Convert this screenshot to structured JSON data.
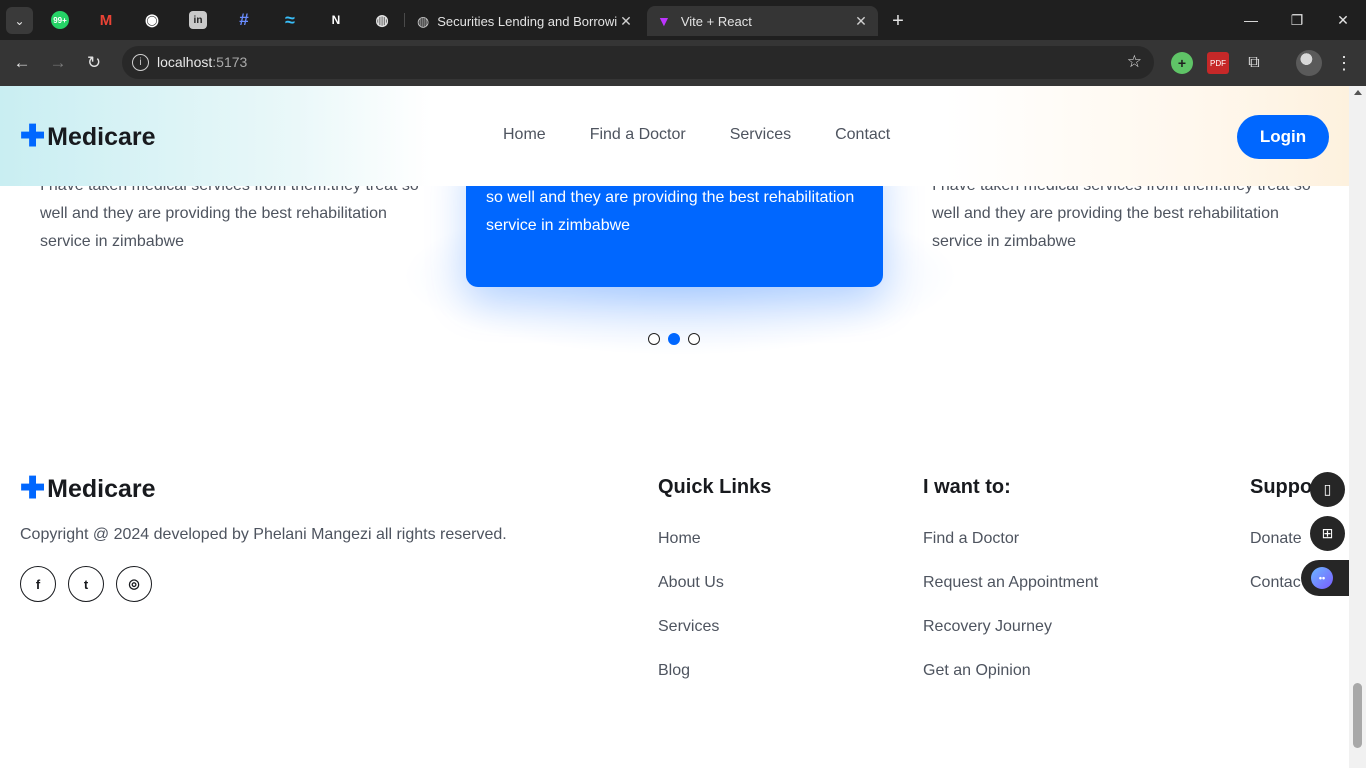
{
  "browser": {
    "tabs": [
      {
        "title": "Securities Lending and Borrowin"
      },
      {
        "title": "Vite + React"
      }
    ],
    "pinned_tabs": [
      {
        "icon": "whatsapp-icon",
        "badge": "99+",
        "color": "#25d366"
      },
      {
        "icon": "gmail-icon",
        "glyph": "M",
        "color": "#ea4335"
      },
      {
        "icon": "github-icon",
        "glyph": "◉",
        "color": "#ffffff"
      },
      {
        "icon": "linkedin-icon",
        "glyph": "in",
        "color": "#0a66c2"
      },
      {
        "icon": "hash-icon",
        "glyph": "#",
        "color": "#6a8dff"
      },
      {
        "icon": "tailwind-icon",
        "glyph": "≈",
        "color": "#38bdf8"
      },
      {
        "icon": "notion-icon",
        "glyph": "N",
        "color": "#ffffff"
      },
      {
        "icon": "copilot-icon",
        "glyph": "◍",
        "color": "#e3e3e3"
      }
    ],
    "address": {
      "host": "localhost",
      "port": ":5173"
    }
  },
  "header": {
    "logo_mark": "✚",
    "logo_text": "Medicare",
    "nav": [
      "Home",
      "Find a Doctor",
      "Services",
      "Contact"
    ],
    "login_label": "Login"
  },
  "testimonials": {
    "left": "I have taken medical services from them.they treat so well and they are providing the best rehabilitation service in zimbabwe",
    "center": "I have taken medical services from them.they treat so well and they are providing the best rehabilitation service in zimbabwe",
    "right": "I have taken medical services from them.they treat so well and they are providing the best rehabilitation service in zimbabwe",
    "active_slide": 2,
    "slide_count": 3
  },
  "footer": {
    "logo_mark": "✚",
    "logo_text": "Medicare",
    "copyright": "Copyright @ 2024 developed by Phelani Mangezi all rights reserved.",
    "social": [
      "facebook-icon",
      "twitter-icon",
      "instagram-icon"
    ],
    "quick_links": {
      "title": "Quick Links",
      "links": [
        "Home",
        "About Us",
        "Services",
        "Blog"
      ]
    },
    "i_want_to": {
      "title": "I want to:",
      "links": [
        "Find a Doctor",
        "Request an Appointment",
        "Recovery Journey",
        "Get an Opinion"
      ]
    },
    "support": {
      "title": "Suppo",
      "links": [
        "Donate",
        "Contac"
      ]
    }
  },
  "colors": {
    "primary": "#0067ff",
    "heading": "#181a1e",
    "text": "#4e545f"
  }
}
